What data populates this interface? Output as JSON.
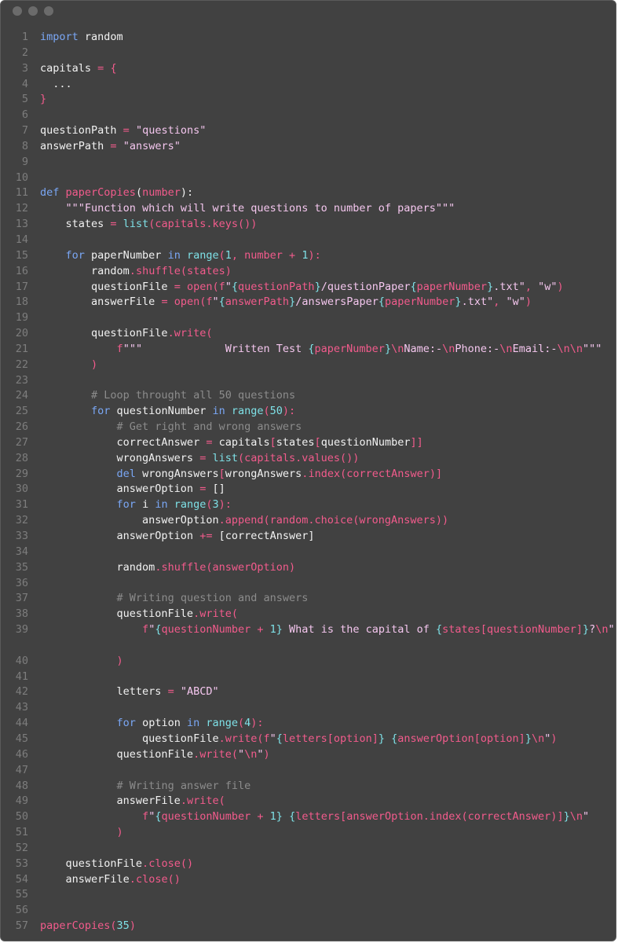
{
  "window": {
    "controls": [
      "close-dot",
      "minimize-dot",
      "maximize-dot"
    ]
  },
  "lines": [
    {
      "n": "1",
      "t": [
        [
          "kw",
          "import"
        ],
        [
          "pl",
          " random"
        ]
      ]
    },
    {
      "n": "2",
      "t": []
    },
    {
      "n": "3",
      "t": [
        [
          "pl",
          "capitals "
        ],
        [
          "op",
          "="
        ],
        [
          "pl",
          " "
        ],
        [
          "op",
          "{"
        ]
      ]
    },
    {
      "n": "4",
      "t": [
        [
          "pl",
          "  ..."
        ]
      ]
    },
    {
      "n": "5",
      "t": [
        [
          "op",
          "}"
        ]
      ]
    },
    {
      "n": "6",
      "t": []
    },
    {
      "n": "7",
      "t": [
        [
          "pl",
          "questionPath "
        ],
        [
          "op",
          "="
        ],
        [
          "pl",
          " "
        ],
        [
          "st",
          "\"questions\""
        ]
      ]
    },
    {
      "n": "8",
      "t": [
        [
          "pl",
          "answerPath "
        ],
        [
          "op",
          "="
        ],
        [
          "pl",
          " "
        ],
        [
          "st",
          "\"answers\""
        ]
      ]
    },
    {
      "n": "9",
      "t": []
    },
    {
      "n": "10",
      "t": []
    },
    {
      "n": "11",
      "t": [
        [
          "kw",
          "def"
        ],
        [
          "pl",
          " "
        ],
        [
          "fn",
          "paperCopies"
        ],
        [
          "pl",
          "("
        ],
        [
          "fn",
          "number"
        ],
        [
          "pl",
          "):"
        ]
      ]
    },
    {
      "n": "12",
      "t": [
        [
          "pl",
          "    "
        ],
        [
          "st",
          "\"\"\"Function which will write questions to number of papers\"\"\""
        ]
      ]
    },
    {
      "n": "13",
      "t": [
        [
          "pl",
          "    states "
        ],
        [
          "op",
          "="
        ],
        [
          "pl",
          " "
        ],
        [
          "bi",
          "list"
        ],
        [
          "fx",
          "(capitals.keys())"
        ]
      ]
    },
    {
      "n": "14",
      "t": []
    },
    {
      "n": "15",
      "t": [
        [
          "pl",
          "    "
        ],
        [
          "kw",
          "for"
        ],
        [
          "pl",
          " paperNumber "
        ],
        [
          "kw",
          "in"
        ],
        [
          "pl",
          " "
        ],
        [
          "bi",
          "range"
        ],
        [
          "fx",
          "("
        ],
        [
          "nm",
          "1"
        ],
        [
          "fx",
          ", number + "
        ],
        [
          "nm",
          "1"
        ],
        [
          "fx",
          "):"
        ]
      ]
    },
    {
      "n": "16",
      "t": [
        [
          "pl",
          "        random"
        ],
        [
          "op",
          "."
        ],
        [
          "fx",
          "shuffle(states)"
        ]
      ]
    },
    {
      "n": "17",
      "t": [
        [
          "pl",
          "        questionFile "
        ],
        [
          "op",
          "="
        ],
        [
          "pl",
          " "
        ],
        [
          "fx",
          "open(f"
        ],
        [
          "st",
          "\""
        ],
        [
          "nm",
          "{"
        ],
        [
          "fx",
          "questionPath"
        ],
        [
          "nm",
          "}"
        ],
        [
          "st",
          "/questionPaper"
        ],
        [
          "nm",
          "{"
        ],
        [
          "fx",
          "paperNumber"
        ],
        [
          "nm",
          "}"
        ],
        [
          "st",
          ".txt\""
        ],
        [
          "fx",
          ", "
        ],
        [
          "st",
          "\"w\""
        ],
        [
          "fx",
          ")"
        ]
      ]
    },
    {
      "n": "18",
      "t": [
        [
          "pl",
          "        answerFile "
        ],
        [
          "op",
          "="
        ],
        [
          "pl",
          " "
        ],
        [
          "fx",
          "open(f"
        ],
        [
          "st",
          "\""
        ],
        [
          "nm",
          "{"
        ],
        [
          "fx",
          "answerPath"
        ],
        [
          "nm",
          "}"
        ],
        [
          "st",
          "/answersPaper"
        ],
        [
          "nm",
          "{"
        ],
        [
          "fx",
          "paperNumber"
        ],
        [
          "nm",
          "}"
        ],
        [
          "st",
          ".txt\""
        ],
        [
          "fx",
          ", "
        ],
        [
          "st",
          "\"w\""
        ],
        [
          "fx",
          ")"
        ]
      ]
    },
    {
      "n": "19",
      "t": []
    },
    {
      "n": "20",
      "t": [
        [
          "pl",
          "        questionFile"
        ],
        [
          "op",
          "."
        ],
        [
          "fx",
          "write("
        ]
      ]
    },
    {
      "n": "21",
      "t": [
        [
          "pl",
          "            "
        ],
        [
          "fx",
          "f"
        ],
        [
          "st",
          "\"\"\"             Written Test "
        ],
        [
          "nm",
          "{"
        ],
        [
          "fx",
          "paperNumber"
        ],
        [
          "nm",
          "}"
        ],
        [
          "fx",
          "\\n"
        ],
        [
          "st",
          "Name:-"
        ],
        [
          "fx",
          "\\n"
        ],
        [
          "st",
          "Phone:-"
        ],
        [
          "fx",
          "\\n"
        ],
        [
          "st",
          "Email:-"
        ],
        [
          "fx",
          "\\n\\n"
        ],
        [
          "st",
          "\"\"\""
        ]
      ]
    },
    {
      "n": "22",
      "t": [
        [
          "pl",
          "        "
        ],
        [
          "fx",
          ")"
        ]
      ]
    },
    {
      "n": "23",
      "t": []
    },
    {
      "n": "24",
      "t": [
        [
          "pl",
          "        "
        ],
        [
          "cm",
          "# Loop throught all 50 questions"
        ]
      ]
    },
    {
      "n": "25",
      "t": [
        [
          "pl",
          "        "
        ],
        [
          "kw",
          "for"
        ],
        [
          "pl",
          " questionNumber "
        ],
        [
          "kw",
          "in"
        ],
        [
          "pl",
          " "
        ],
        [
          "bi",
          "range"
        ],
        [
          "fx",
          "("
        ],
        [
          "nm",
          "50"
        ],
        [
          "fx",
          "):"
        ]
      ]
    },
    {
      "n": "26",
      "t": [
        [
          "pl",
          "            "
        ],
        [
          "cm",
          "# Get right and wrong answers"
        ]
      ]
    },
    {
      "n": "27",
      "t": [
        [
          "pl",
          "            correctAnswer "
        ],
        [
          "op",
          "="
        ],
        [
          "pl",
          " capitals"
        ],
        [
          "fx",
          "["
        ],
        [
          "pl",
          "states"
        ],
        [
          "fx",
          "["
        ],
        [
          "pl",
          "questionNumber"
        ],
        [
          "fx",
          "]]"
        ]
      ]
    },
    {
      "n": "28",
      "t": [
        [
          "pl",
          "            wrongAnswers "
        ],
        [
          "op",
          "="
        ],
        [
          "pl",
          " "
        ],
        [
          "bi",
          "list"
        ],
        [
          "fx",
          "(capitals.values())"
        ]
      ]
    },
    {
      "n": "29",
      "t": [
        [
          "pl",
          "            "
        ],
        [
          "kw",
          "del"
        ],
        [
          "pl",
          " wrongAnswers"
        ],
        [
          "fx",
          "["
        ],
        [
          "pl",
          "wrongAnswers"
        ],
        [
          "op",
          "."
        ],
        [
          "fx",
          "index(correctAnswer)]"
        ]
      ]
    },
    {
      "n": "30",
      "t": [
        [
          "pl",
          "            answerOption "
        ],
        [
          "op",
          "="
        ],
        [
          "pl",
          " []"
        ]
      ]
    },
    {
      "n": "31",
      "t": [
        [
          "pl",
          "            "
        ],
        [
          "kw",
          "for"
        ],
        [
          "pl",
          " i "
        ],
        [
          "kw",
          "in"
        ],
        [
          "pl",
          " "
        ],
        [
          "bi",
          "range"
        ],
        [
          "fx",
          "("
        ],
        [
          "nm",
          "3"
        ],
        [
          "fx",
          "):"
        ]
      ]
    },
    {
      "n": "32",
      "t": [
        [
          "pl",
          "                answerOption"
        ],
        [
          "op",
          "."
        ],
        [
          "fx",
          "append(random.choice(wrongAnswers))"
        ]
      ]
    },
    {
      "n": "33",
      "t": [
        [
          "pl",
          "            answerOption "
        ],
        [
          "op",
          "+="
        ],
        [
          "pl",
          " [correctAnswer]"
        ]
      ]
    },
    {
      "n": "34",
      "t": []
    },
    {
      "n": "35",
      "t": [
        [
          "pl",
          "            random"
        ],
        [
          "op",
          "."
        ],
        [
          "fx",
          "shuffle(answerOption)"
        ]
      ]
    },
    {
      "n": "36",
      "t": []
    },
    {
      "n": "37",
      "t": [
        [
          "pl",
          "            "
        ],
        [
          "cm",
          "# Writing question and answers"
        ]
      ]
    },
    {
      "n": "38",
      "t": [
        [
          "pl",
          "            questionFile"
        ],
        [
          "op",
          "."
        ],
        [
          "fx",
          "write("
        ]
      ]
    },
    {
      "n": "39",
      "tall": true,
      "t": [
        [
          "pl",
          "                "
        ],
        [
          "fx",
          "f"
        ],
        [
          "st",
          "\""
        ],
        [
          "nm",
          "{"
        ],
        [
          "fx",
          "questionNumber + "
        ],
        [
          "nm",
          "1"
        ],
        [
          "nm",
          "}"
        ],
        [
          "st",
          " What is the capital of "
        ],
        [
          "nm",
          "{"
        ],
        [
          "fx",
          "states[questionNumber]"
        ],
        [
          "nm",
          "}"
        ],
        [
          "st",
          "?"
        ],
        [
          "fx",
          "\\n"
        ],
        [
          "st",
          "\""
        ]
      ]
    },
    {
      "n": "40",
      "t": [
        [
          "pl",
          "            "
        ],
        [
          "fx",
          ")"
        ]
      ]
    },
    {
      "n": "41",
      "t": []
    },
    {
      "n": "42",
      "t": [
        [
          "pl",
          "            letters "
        ],
        [
          "op",
          "="
        ],
        [
          "pl",
          " "
        ],
        [
          "st",
          "\"ABCD\""
        ]
      ]
    },
    {
      "n": "43",
      "t": []
    },
    {
      "n": "44",
      "t": [
        [
          "pl",
          "            "
        ],
        [
          "kw",
          "for"
        ],
        [
          "pl",
          " option "
        ],
        [
          "kw",
          "in"
        ],
        [
          "pl",
          " "
        ],
        [
          "bi",
          "range"
        ],
        [
          "fx",
          "("
        ],
        [
          "nm",
          "4"
        ],
        [
          "fx",
          "):"
        ]
      ]
    },
    {
      "n": "45",
      "t": [
        [
          "pl",
          "                questionFile"
        ],
        [
          "op",
          "."
        ],
        [
          "fx",
          "write(f"
        ],
        [
          "st",
          "\""
        ],
        [
          "nm",
          "{"
        ],
        [
          "fx",
          "letters[option]"
        ],
        [
          "nm",
          "}"
        ],
        [
          "st",
          " "
        ],
        [
          "nm",
          "{"
        ],
        [
          "fx",
          "answerOption[option]"
        ],
        [
          "nm",
          "}"
        ],
        [
          "fx",
          "\\n"
        ],
        [
          "st",
          "\""
        ],
        [
          "fx",
          ")"
        ]
      ]
    },
    {
      "n": "46",
      "t": [
        [
          "pl",
          "            questionFile"
        ],
        [
          "op",
          "."
        ],
        [
          "fx",
          "write("
        ],
        [
          "st",
          "\""
        ],
        [
          "fx",
          "\\n"
        ],
        [
          "st",
          "\""
        ],
        [
          "fx",
          ")"
        ]
      ]
    },
    {
      "n": "47",
      "t": []
    },
    {
      "n": "48",
      "t": [
        [
          "pl",
          "            "
        ],
        [
          "cm",
          "# Writing answer file"
        ]
      ]
    },
    {
      "n": "49",
      "t": [
        [
          "pl",
          "            answerFile"
        ],
        [
          "op",
          "."
        ],
        [
          "fx",
          "write("
        ]
      ]
    },
    {
      "n": "50",
      "t": [
        [
          "pl",
          "                "
        ],
        [
          "fx",
          "f"
        ],
        [
          "st",
          "\""
        ],
        [
          "nm",
          "{"
        ],
        [
          "fx",
          "questionNumber + "
        ],
        [
          "nm",
          "1"
        ],
        [
          "nm",
          "}"
        ],
        [
          "st",
          " "
        ],
        [
          "nm",
          "{"
        ],
        [
          "fx",
          "letters[answerOption.index(correctAnswer)]"
        ],
        [
          "nm",
          "}"
        ],
        [
          "fx",
          "\\n"
        ],
        [
          "st",
          "\""
        ]
      ]
    },
    {
      "n": "51",
      "t": [
        [
          "pl",
          "            "
        ],
        [
          "fx",
          ")"
        ]
      ]
    },
    {
      "n": "52",
      "t": []
    },
    {
      "n": "53",
      "t": [
        [
          "pl",
          "    questionFile"
        ],
        [
          "op",
          "."
        ],
        [
          "fx",
          "close()"
        ]
      ]
    },
    {
      "n": "54",
      "t": [
        [
          "pl",
          "    answerFile"
        ],
        [
          "op",
          "."
        ],
        [
          "fx",
          "close()"
        ]
      ]
    },
    {
      "n": "55",
      "t": []
    },
    {
      "n": "56",
      "t": []
    },
    {
      "n": "57",
      "t": [
        [
          "fn",
          "paperCopies"
        ],
        [
          "fx",
          "("
        ],
        [
          "nm",
          "35"
        ],
        [
          "fx",
          ")"
        ]
      ]
    }
  ]
}
